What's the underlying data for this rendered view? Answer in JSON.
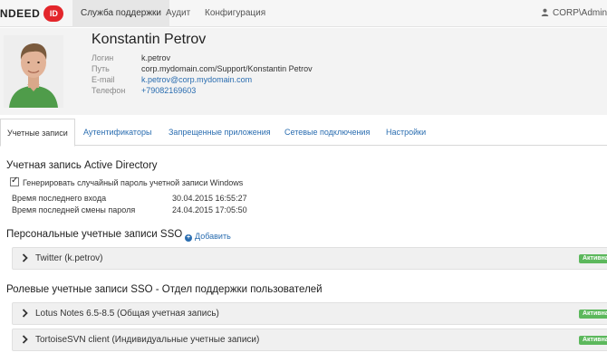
{
  "navbar": {
    "logo_text": "INDEED",
    "logo_badge": "ID",
    "tabs": [
      {
        "label": "Служба поддержки",
        "active": true
      },
      {
        "label": "Аудит",
        "active": false
      },
      {
        "label": "Конфигурация",
        "active": false
      }
    ],
    "user": "CORP\\Admin"
  },
  "profile": {
    "name": "Konstantin Petrov",
    "fields": [
      {
        "key": "Логин",
        "value": "k.petrov"
      },
      {
        "key": "Путь",
        "value": "corp.mydomain.com/Support/Konstantin Petrov"
      },
      {
        "key": "E-mail",
        "value": "k.petrov@corp.mydomain.com"
      },
      {
        "key": "Телефон",
        "value": "+79082169603"
      }
    ]
  },
  "tabs": [
    {
      "label": "Учетные записи",
      "active": true
    },
    {
      "label": "Аутентификаторы",
      "active": false
    },
    {
      "label": "Запрещенные приложения",
      "active": false
    },
    {
      "label": "Сетевые подключения",
      "active": false
    },
    {
      "label": "Настройки",
      "active": false
    }
  ],
  "ad": {
    "title": "Учетная запись Active Directory",
    "checkbox_label": "Генерировать случайный пароль учетной записи Windows",
    "checkbox_checked": true,
    "rows": [
      {
        "key": "Время последнего входа",
        "value": "30.04.2015 16:55:27"
      },
      {
        "key": "Время последней смены пароля",
        "value": "24.04.2015 17:05:50"
      }
    ]
  },
  "personal_sso": {
    "title": "Персональные учетные записи SSO",
    "add_label": "Добавить",
    "items": [
      {
        "label": "Twitter (k.petrov)",
        "status": "Активна"
      }
    ]
  },
  "role_sso": {
    "title": "Ролевые учетные записи SSO - Отдел поддержки пользователей",
    "items": [
      {
        "label": "Lotus Notes 6.5-8.5 (Общая учетная запись)",
        "status": "Активна"
      },
      {
        "label": "TortoiseSVN client (Индивидуальные учетные записи)",
        "status": "Активна"
      }
    ]
  },
  "colors": {
    "link": "#2a6db0",
    "active_badge": "#5cb85c",
    "logo_red": "#e3262b"
  }
}
